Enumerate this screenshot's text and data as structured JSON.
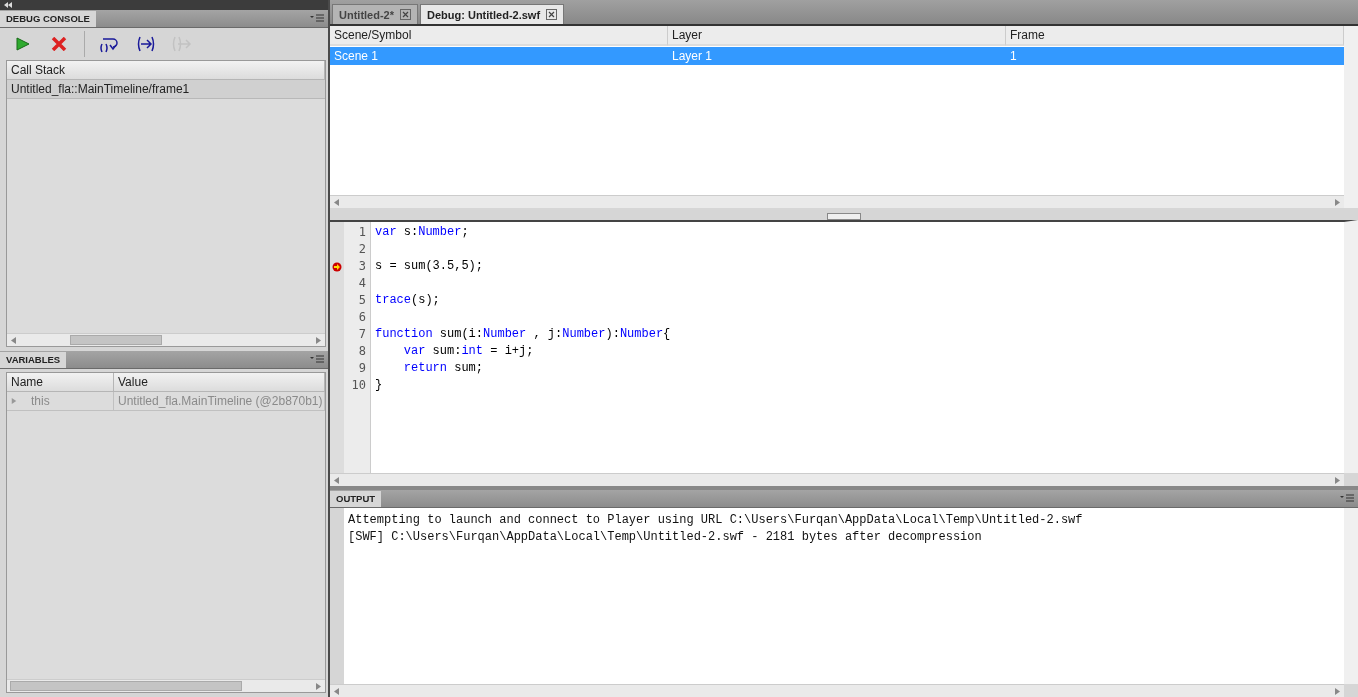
{
  "debug_console": {
    "title": "DEBUG CONSOLE",
    "toolbar": [
      {
        "kind": "continue",
        "disabled": false
      },
      {
        "kind": "stop",
        "disabled": false
      },
      {
        "kind": "step_over",
        "disabled": false
      },
      {
        "kind": "step_in",
        "disabled": false
      },
      {
        "kind": "step_out",
        "disabled": true
      }
    ],
    "call_stack": {
      "header": "Call Stack",
      "rows": [
        {
          "text": "Untitled_fla::MainTimeline/frame1",
          "selected": true
        }
      ]
    }
  },
  "variables": {
    "title": "VARIABLES",
    "columns": [
      "Name",
      "Value"
    ],
    "rows": [
      {
        "name": "this",
        "value": "Untitled_fla.MainTimeline (@2b870b1)",
        "expanded": false
      }
    ]
  },
  "tabs": [
    {
      "label": "Untitled-2*",
      "selected": false
    },
    {
      "label": "Debug: Untitled-2.swf",
      "selected": true
    }
  ],
  "scenes": {
    "columns": [
      "Scene/Symbol",
      "Layer",
      "Frame"
    ],
    "rows": [
      {
        "cells": [
          "Scene 1",
          "Layer 1",
          "1"
        ],
        "selected": true
      }
    ]
  },
  "code": [
    {
      "number": "1",
      "marker": false,
      "indent": false,
      "tokens": [
        {
          "text": "var",
          "kind": "keyword"
        },
        {
          "text": " s:",
          "kind": "plain"
        },
        {
          "text": "Number",
          "kind": "keyword"
        },
        {
          "text": ";",
          "kind": "plain"
        }
      ]
    },
    {
      "number": "2",
      "marker": false
    },
    {
      "number": "3",
      "marker": true,
      "indent": false,
      "tokens": [
        {
          "text": "s = sum(3.5,5);",
          "kind": "plain"
        }
      ]
    },
    {
      "number": "4",
      "marker": false
    },
    {
      "number": "5",
      "marker": false,
      "indent": false,
      "tokens": [
        {
          "text": "trace",
          "kind": "keyword"
        },
        {
          "text": "(s);",
          "kind": "plain"
        }
      ]
    },
    {
      "number": "6",
      "marker": false
    },
    {
      "number": "7",
      "marker": false,
      "indent": false,
      "tokens": [
        {
          "text": "function",
          "kind": "keyword"
        },
        {
          "text": " sum(i:",
          "kind": "plain"
        },
        {
          "text": "Number",
          "kind": "keyword"
        },
        {
          "text": " , j:",
          "kind": "plain"
        },
        {
          "text": "Number",
          "kind": "keyword"
        },
        {
          "text": "):",
          "kind": "plain"
        },
        {
          "text": "Number",
          "kind": "keyword"
        },
        {
          "text": "{",
          "kind": "plain"
        }
      ]
    },
    {
      "number": "8",
      "marker": false,
      "indent": true,
      "tokens": [
        {
          "text": "var",
          "kind": "keyword"
        },
        {
          "text": " sum:",
          "kind": "plain"
        },
        {
          "text": "int",
          "kind": "keyword"
        },
        {
          "text": " = i+j;",
          "kind": "plain"
        }
      ]
    },
    {
      "number": "9",
      "marker": false,
      "indent": true,
      "tokens": [
        {
          "text": "return",
          "kind": "keyword"
        },
        {
          "text": " sum;",
          "kind": "plain"
        }
      ]
    },
    {
      "number": "10",
      "marker": false,
      "indent": false,
      "tokens": [
        {
          "text": "}",
          "kind": "plain"
        }
      ]
    }
  ],
  "output": {
    "title": "OUTPUT",
    "lines": [
      "Attempting to launch and connect to Player using URL C:\\Users\\Furqan\\AppData\\Local\\Temp\\Untitled-2.swf",
      "[SWF] C:\\Users\\Furqan\\AppData\\Local\\Temp\\Untitled-2.swf - 2181 bytes after decompression"
    ]
  }
}
